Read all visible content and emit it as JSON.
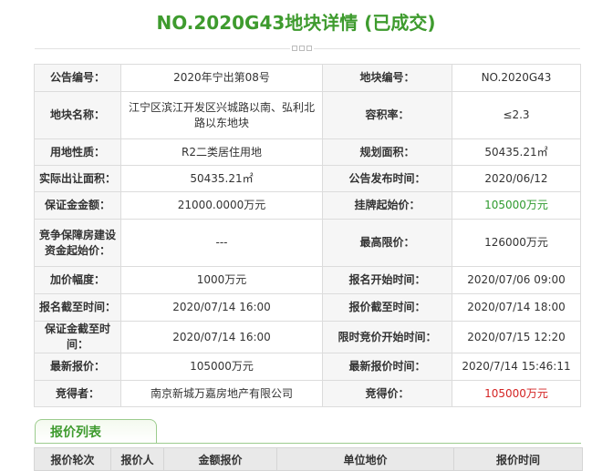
{
  "title": "NO.2020G43地块详情 (已成交)",
  "rows": [
    {
      "l1": "公告编号：",
      "v1": "2020年宁出第08号",
      "l2": "地块编号：",
      "v2": "NO.2020G43"
    },
    {
      "l1": "地块名称：",
      "v1": "江宁区滨江开发区兴城路以南、弘利北路以东地块",
      "l2": "容积率：",
      "v2": "≤2.3"
    },
    {
      "l1": "用地性质：",
      "v1": "R2二类居住用地",
      "l2": "规划面积：",
      "v2": "50435.21㎡"
    },
    {
      "l1": "实际出让面积：",
      "v1": "50435.21㎡",
      "l2": "公告发布时间：",
      "v2": "2020/06/12"
    },
    {
      "l1": "保证金金额：",
      "v1": "21000.0000万元",
      "l2": "挂牌起始价：",
      "v2": "105000万元"
    },
    {
      "l1": "竞争保障房建设资金起始价：",
      "v1": "---",
      "l2": "最高限价：",
      "v2": "126000万元"
    },
    {
      "l1": "加价幅度：",
      "v1": "1000万元",
      "l2": "报名开始时间：",
      "v2": "2020/07/06 09:00"
    },
    {
      "l1": "报名截至时间：",
      "v1": "2020/07/14 16:00",
      "l2": "报价截至时间：",
      "v2": "2020/07/14 18:00"
    },
    {
      "l1": "保证金截至时间：",
      "v1": "2020/07/14 16:00",
      "l2": "限时竞价开始时间：",
      "v2": "2020/07/15 12:20"
    },
    {
      "l1": "最新报价：",
      "v1": "105000万元",
      "l2": "最新报价时间：",
      "v2": "2020/7/14 15:46:11"
    },
    {
      "l1": "竞得者：",
      "v1": "南京新城万嘉房地产有限公司",
      "l2": "竞得价：",
      "v2": "105000万元"
    }
  ],
  "colors": {
    "accent": "#3e9b2e",
    "start_price": "#2e9a2e",
    "winning_price": "#d42424"
  },
  "offers_tab": "报价列表",
  "offers_headers": [
    "报价轮次",
    "报价人",
    "金额报价",
    "单位地价",
    "报价时间"
  ]
}
